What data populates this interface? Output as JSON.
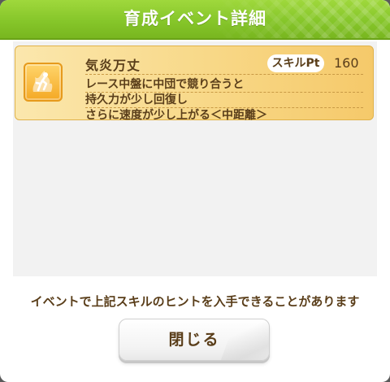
{
  "dialog": {
    "title": "育成イベント詳細"
  },
  "skill": {
    "icon": "running-flame-icon",
    "name": "気炎万丈",
    "pt_label": "スキルPt",
    "pt_value": "160",
    "description": [
      "レース中盤に中団で競り合うと",
      "持久力が少し回復し",
      "さらに速度が少し上がる＜中距離＞"
    ]
  },
  "hint": "イベントで上記スキルのヒントを入手できることがあります",
  "buttons": {
    "close_label": "閉じる"
  },
  "colors": {
    "header_green": "#86c62a",
    "card_gold": "#f8d887",
    "text_brown": "#5a3e1a"
  }
}
